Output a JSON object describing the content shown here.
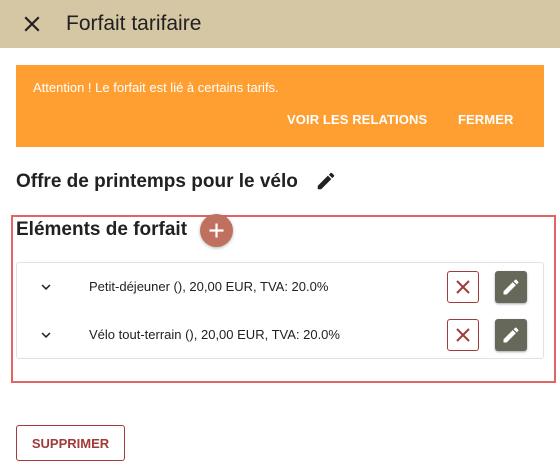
{
  "header": {
    "title": "Forfait tarifaire",
    "close_icon": "close-icon"
  },
  "alert": {
    "message": "Attention ! Le forfait est lié à certains tarifs.",
    "relations_label": "VOIR LES RELATIONS",
    "dismiss_label": "FERMER",
    "background": "#ff9f32"
  },
  "offer": {
    "name": "Offre de printemps pour le vélo",
    "edit_icon": "pencil-icon"
  },
  "elements": {
    "title": "Eléments de forfait",
    "add_icon": "plus-icon",
    "items": [
      {
        "label": "Petit-déjeuner (), 20,00 EUR, TVA: 20.0%"
      },
      {
        "label": "Vélo tout-terrain (), 20,00 EUR, TVA: 20.0%"
      }
    ]
  },
  "footer": {
    "delete_label": "SUPPRIMER"
  },
  "colors": {
    "header": "#d5c7a4",
    "accent": "#c0705f",
    "danger": "#a33a3a",
    "edit": "#66695a",
    "highlight": "#e06666"
  }
}
